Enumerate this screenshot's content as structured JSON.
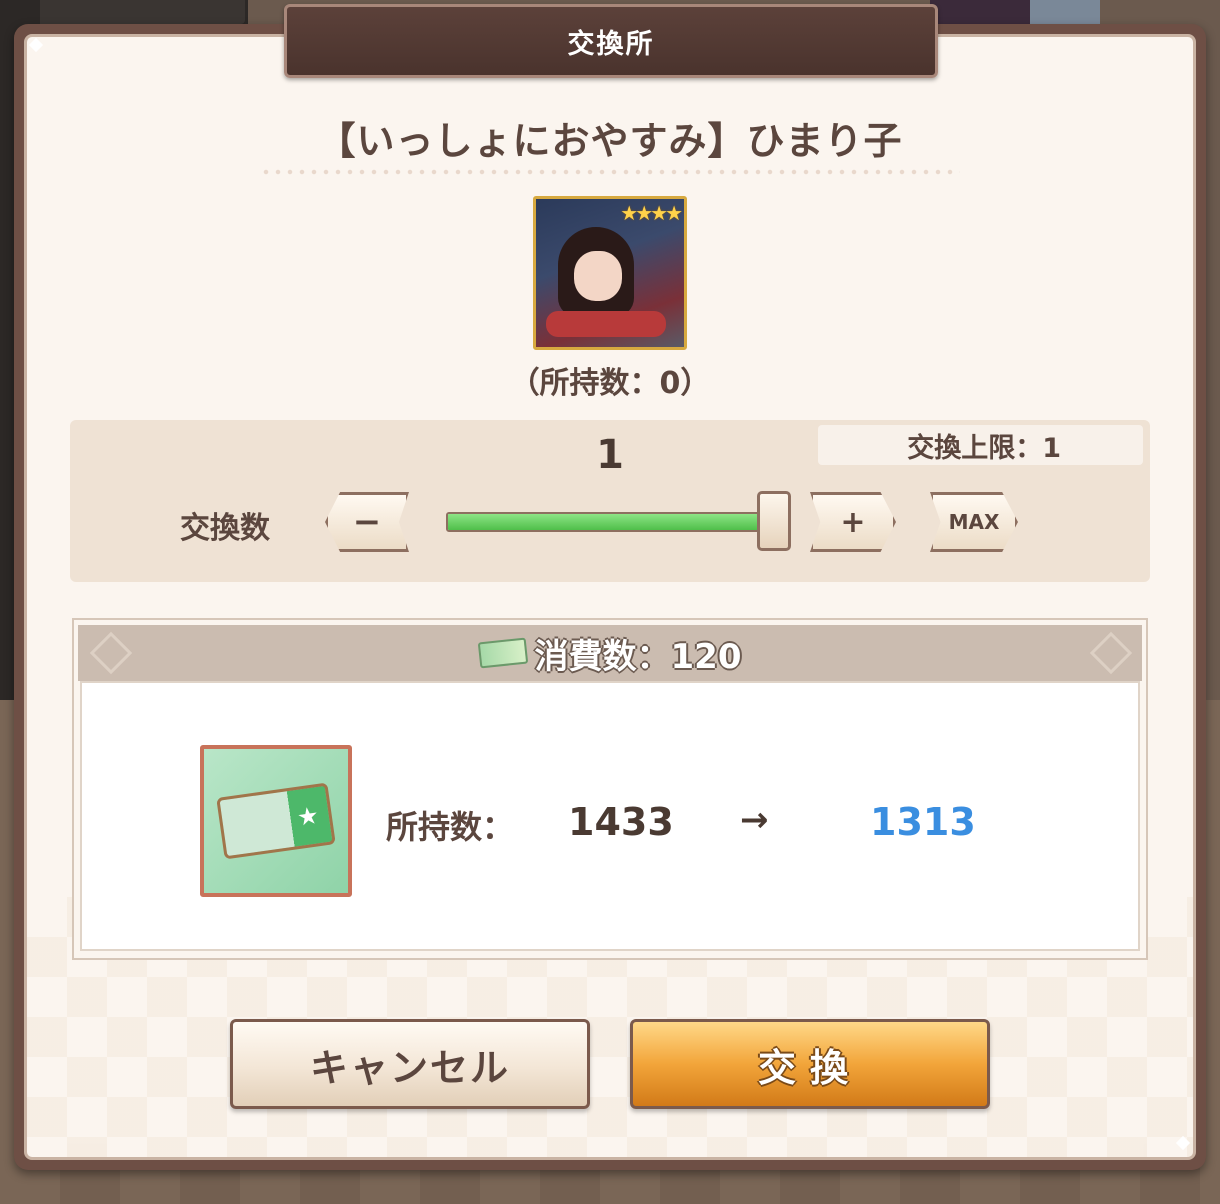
{
  "dialog": {
    "title": "交換所",
    "item_name": "【いっしょにおやすみ】ひまり子",
    "rarity_stars": "★★★★",
    "owned_count": "（所持数：0）"
  },
  "quantity": {
    "value": "1",
    "limit": "交換上限：1",
    "label": "交換数",
    "minus_label": "−",
    "plus_label": "+",
    "max_label": "MAX",
    "slider_fraction": 1.0
  },
  "cost": {
    "header": "消費数：120",
    "stock_label": "所持数：",
    "stock_before": "1433",
    "arrow": "→",
    "stock_after": "1313",
    "ticket_star": "★"
  },
  "buttons": {
    "cancel": "キャンセル",
    "exchange": "交換"
  },
  "colors": {
    "after_value": "#3a8ee0",
    "slider_fill": "#4fbf4a",
    "exchange_button": "#f2a53a"
  }
}
